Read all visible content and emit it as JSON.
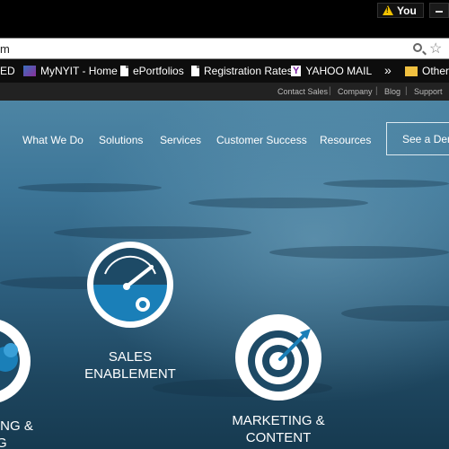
{
  "browser": {
    "profile_button": "You",
    "address_text": "m"
  },
  "bookmarks": [
    {
      "label": "ED"
    },
    {
      "label": "MyNYIT - Home"
    },
    {
      "label": "ePortfolios"
    },
    {
      "label": "Registration Rates"
    },
    {
      "label": "YAHOO MAIL"
    },
    {
      "label": "Other"
    }
  ],
  "bookmarks_overflow": "»",
  "utility_nav": {
    "contact": "Contact Sales",
    "company": "Company",
    "blog": "Blog",
    "support": "Support",
    "separator": "|"
  },
  "main_nav": {
    "what_we_do": "What We Do",
    "solutions": "Solutions",
    "services": "Services",
    "customer_success": "Customer Success",
    "resources": "Resources",
    "demo": "See a Demo"
  },
  "features": {
    "sales": {
      "line1": "SALES",
      "line2": "ENABLEMENT"
    },
    "marketing": {
      "line1": "MARKETING &",
      "line2": "CONTENT"
    },
    "left": {
      "line1": "ING &",
      "line2": "G"
    }
  },
  "colors": {
    "hero_top": "#4d85a4",
    "hero_bottom": "#163a50",
    "accent_blue": "#1a7fb8",
    "dark_navy": "#1d4a66"
  }
}
